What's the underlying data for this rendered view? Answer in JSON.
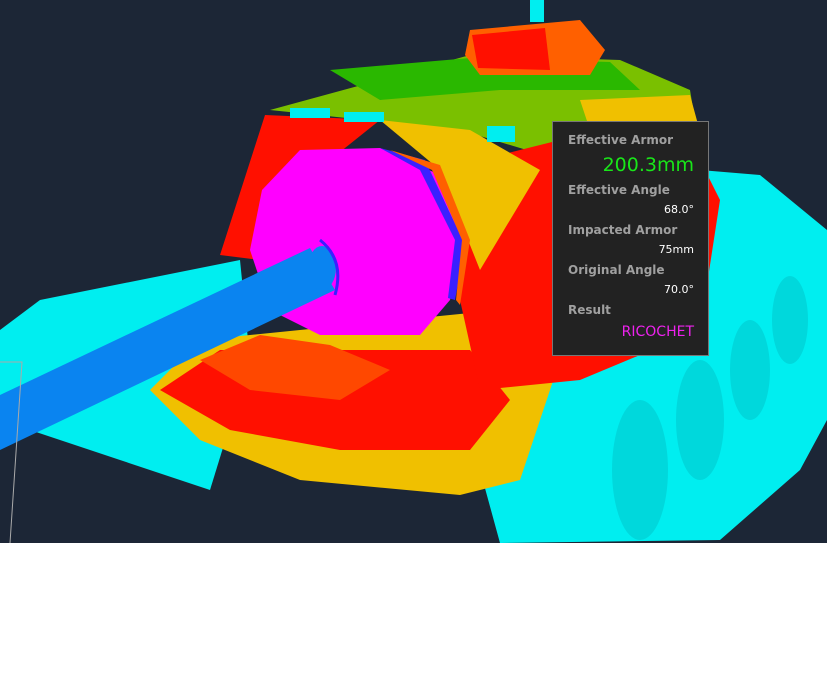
{
  "tooltip": {
    "effective_armor_label": "Effective Armor",
    "effective_armor_value": "200.3mm",
    "effective_angle_label": "Effective Angle",
    "effective_angle_value": "68.0°",
    "impacted_armor_label": "Impacted Armor",
    "impacted_armor_value": "75mm",
    "original_angle_label": "Original Angle",
    "original_angle_value": "70.0°",
    "result_label": "Result",
    "result_value": "RICOCHET"
  },
  "colors": {
    "background": "#1c2636",
    "armor_effective": "#19e619",
    "ricochet": "#ee22ee",
    "tracks": "#00eef0",
    "gun": "#0a84f0",
    "mantlet": "#ff00ff"
  }
}
